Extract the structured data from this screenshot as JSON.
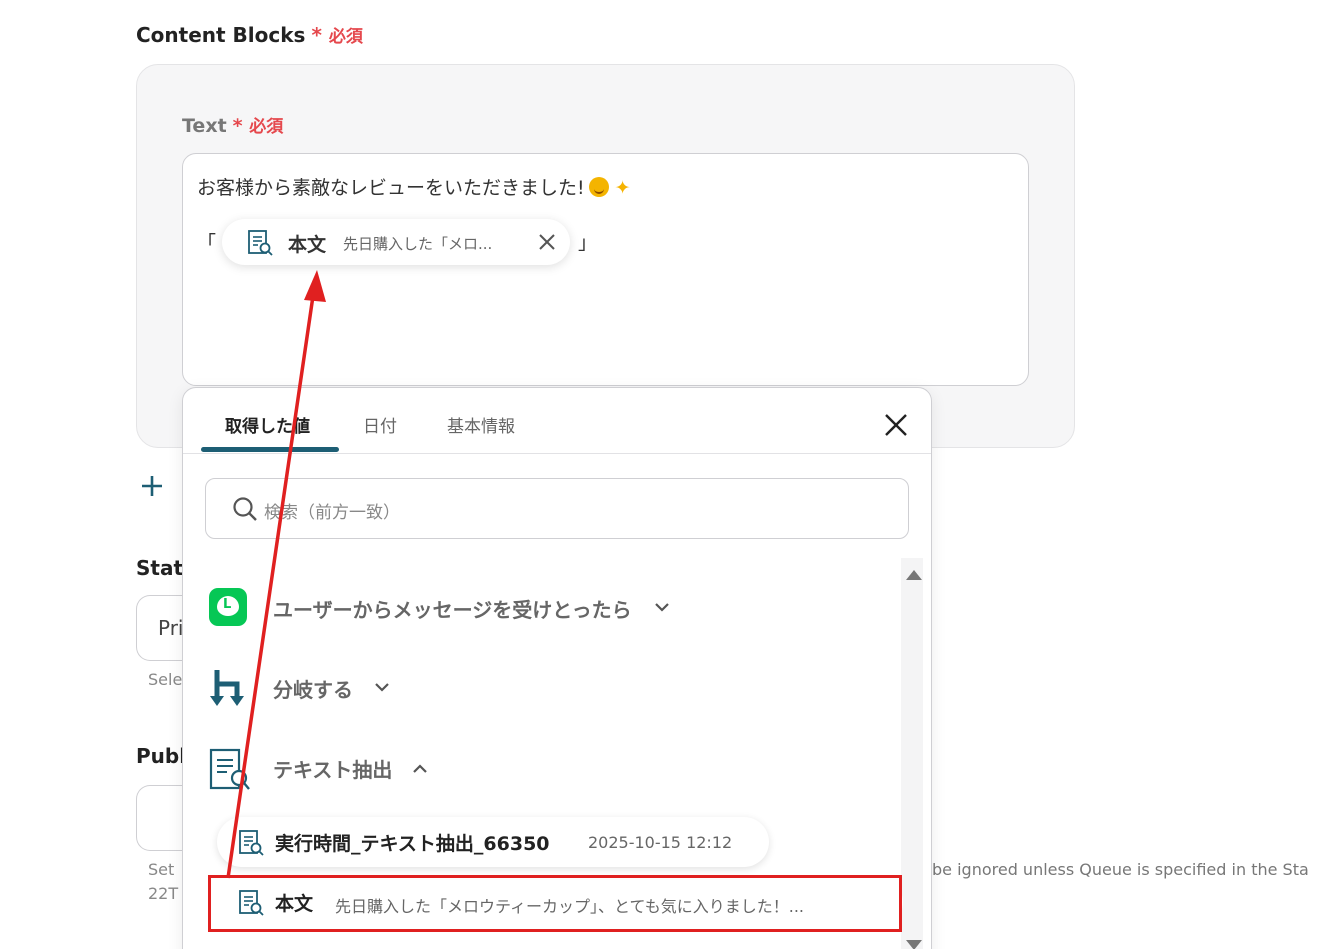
{
  "content_blocks": {
    "label": "Content Blocks",
    "required_star": "*",
    "required_text": "必須"
  },
  "text_field": {
    "label": "Text",
    "required_star": "*",
    "required_text": "必須",
    "line1": "お客様から素敵なレビューをいただきました!",
    "bracket_open": "「",
    "bracket_close": "」",
    "chip": {
      "name": "本文",
      "value": "先日購入した「メロ...",
      "icon": "document-search-icon"
    }
  },
  "add_block": {
    "icon": "plus-icon"
  },
  "status": {
    "label": "Stat",
    "value": "Pri",
    "help": "Sele"
  },
  "publish": {
    "label": "Publ",
    "help_line1": "Set",
    "help_line2": "22T",
    "help_right": "be ignored unless Queue is specified in the Sta"
  },
  "picker": {
    "tabs": [
      "取得した値",
      "日付",
      "基本情報"
    ],
    "active_tab": 0,
    "search_placeholder": "検索（前方一致）",
    "groups": [
      {
        "label": "ユーザーからメッセージを受けとったら",
        "icon": "line-app-icon",
        "expanded": false
      },
      {
        "label": "分岐する",
        "icon": "branch-icon",
        "expanded": false
      },
      {
        "label": "テキスト抽出",
        "icon": "document-search-icon",
        "expanded": true
      }
    ],
    "items": [
      {
        "name": "実行時間_テキスト抽出_66350",
        "value": "2025-10-15 12:12"
      },
      {
        "name": "本文",
        "value": "先日購入した「メロウティーカップ」、とても気に入りました！..."
      }
    ]
  },
  "colors": {
    "accent": "#1d5e74",
    "required": "#e5484d",
    "annotation": "#e02020",
    "line_green": "#06c755"
  }
}
